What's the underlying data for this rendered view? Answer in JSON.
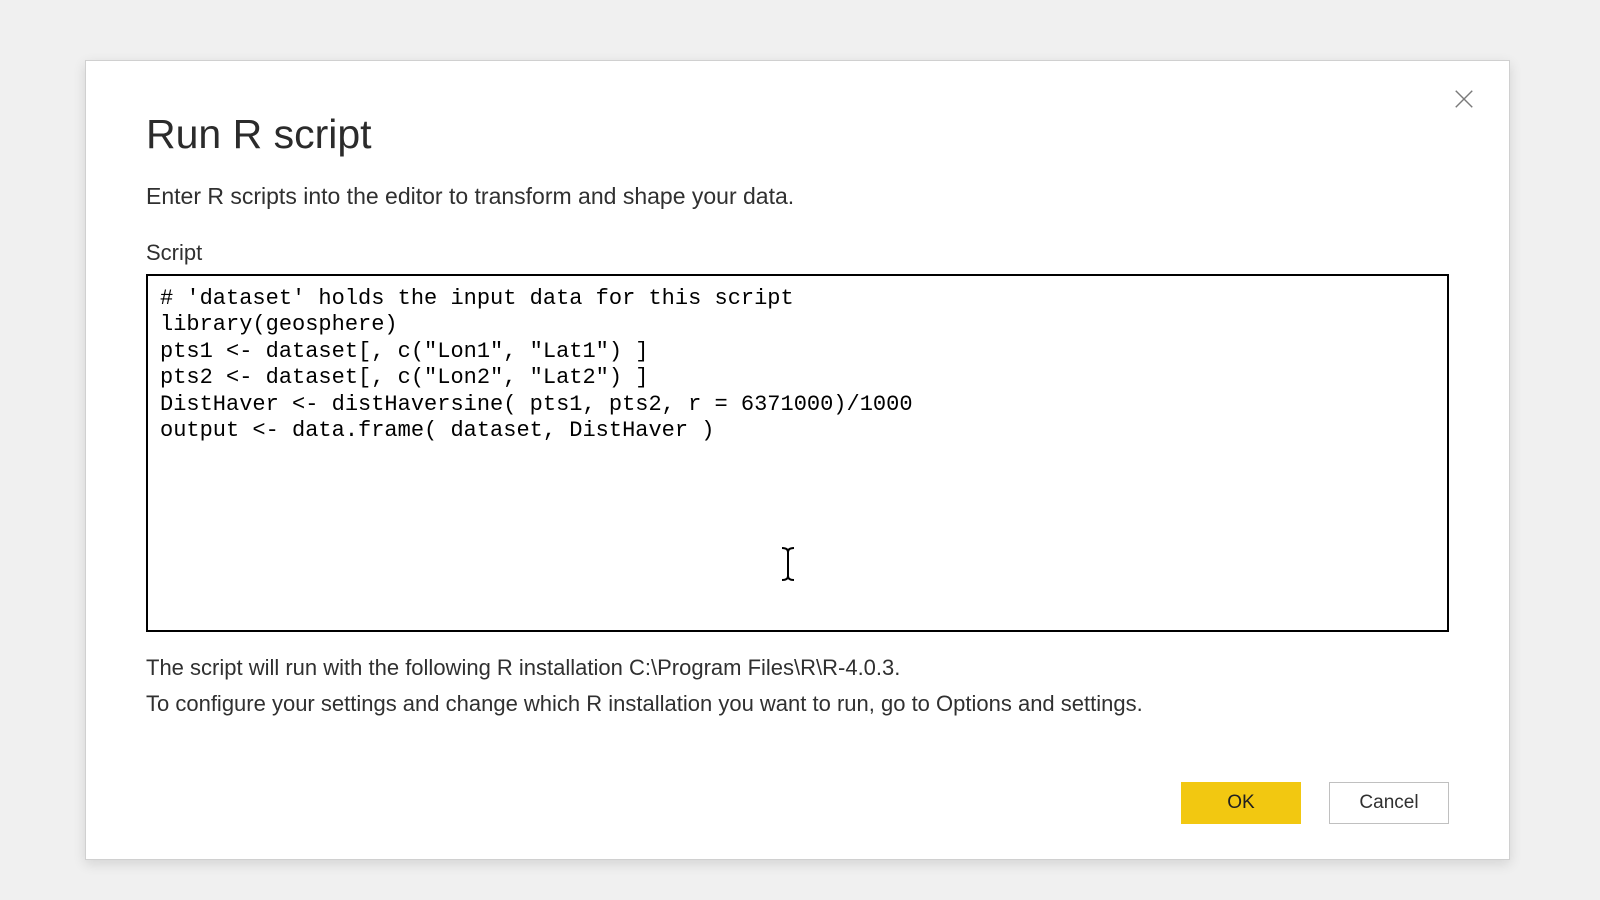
{
  "dialog": {
    "title": "Run R script",
    "subtitle": "Enter R scripts into the editor to transform and shape your data.",
    "field_label": "Script",
    "script_content": "# 'dataset' holds the input data for this script\nlibrary(geosphere)\npts1 <- dataset[, c(\"Lon1\", \"Lat1\") ]\npts2 <- dataset[, c(\"Lon2\", \"Lat2\") ]\nDistHaver <- distHaversine( pts1, pts2, r = 6371000)/1000\noutput <- data.frame( dataset, DistHaver )",
    "footer_line1": "The script will run with the following R installation C:\\Program Files\\R\\R-4.0.3.",
    "footer_line2": "To configure your settings and change which R installation you want to run, go to Options and settings.",
    "ok_label": "OK",
    "cancel_label": "Cancel"
  },
  "colors": {
    "accent": "#f2c811"
  }
}
